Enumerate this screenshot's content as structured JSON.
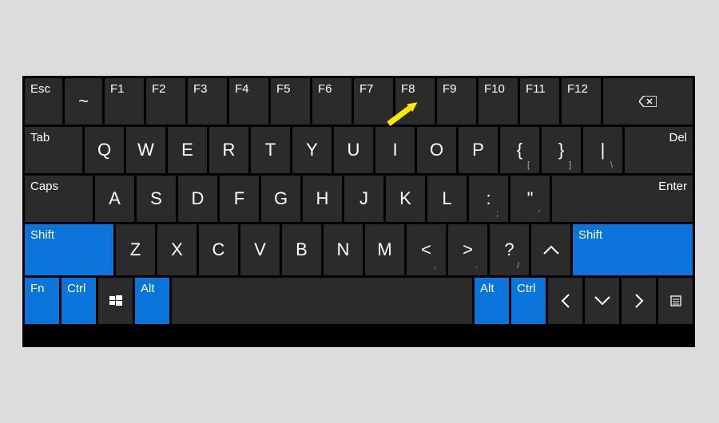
{
  "rows": {
    "r0": {
      "esc": "Esc",
      "tilde": "~",
      "f1": "F1",
      "f2": "F2",
      "f3": "F3",
      "f4": "F4",
      "f5": "F5",
      "f6": "F6",
      "f7": "F7",
      "f8": "F8",
      "f9": "F9",
      "f10": "F10",
      "f11": "F11",
      "f12": "F12"
    },
    "r1": {
      "tab": "Tab",
      "q": "Q",
      "w": "W",
      "e": "E",
      "r": "R",
      "t": "T",
      "y": "Y",
      "u": "U",
      "i": "I",
      "o": "O",
      "p": "P",
      "brl": "{",
      "brl2": "[",
      "brr": "}",
      "brr2": "]",
      "pipe": "|",
      "pipe2": "\\",
      "del": "Del"
    },
    "r2": {
      "caps": "Caps",
      "a": "A",
      "s": "S",
      "d": "D",
      "f": "F",
      "g": "G",
      "h": "H",
      "j": "J",
      "k": "K",
      "l": "L",
      "colon": ":",
      "colon2": ";",
      "quote": "\"",
      "quote2": "'",
      "enter": "Enter"
    },
    "r3": {
      "lshift": "Shift",
      "z": "Z",
      "x": "X",
      "c": "C",
      "v": "V",
      "b": "B",
      "n": "N",
      "m": "M",
      "lt": "<",
      "lt2": ",",
      "gt": ">",
      "gt2": ".",
      "qm": "?",
      "qm2": "/",
      "rshift": "Shift"
    },
    "r4": {
      "fn": "Fn",
      "lctrl": "Ctrl",
      "lalt": "Alt",
      "ralt": "Alt",
      "rctrl": "Ctrl"
    }
  },
  "arrow": {
    "color": "#ffea00",
    "points_to": "F8"
  }
}
